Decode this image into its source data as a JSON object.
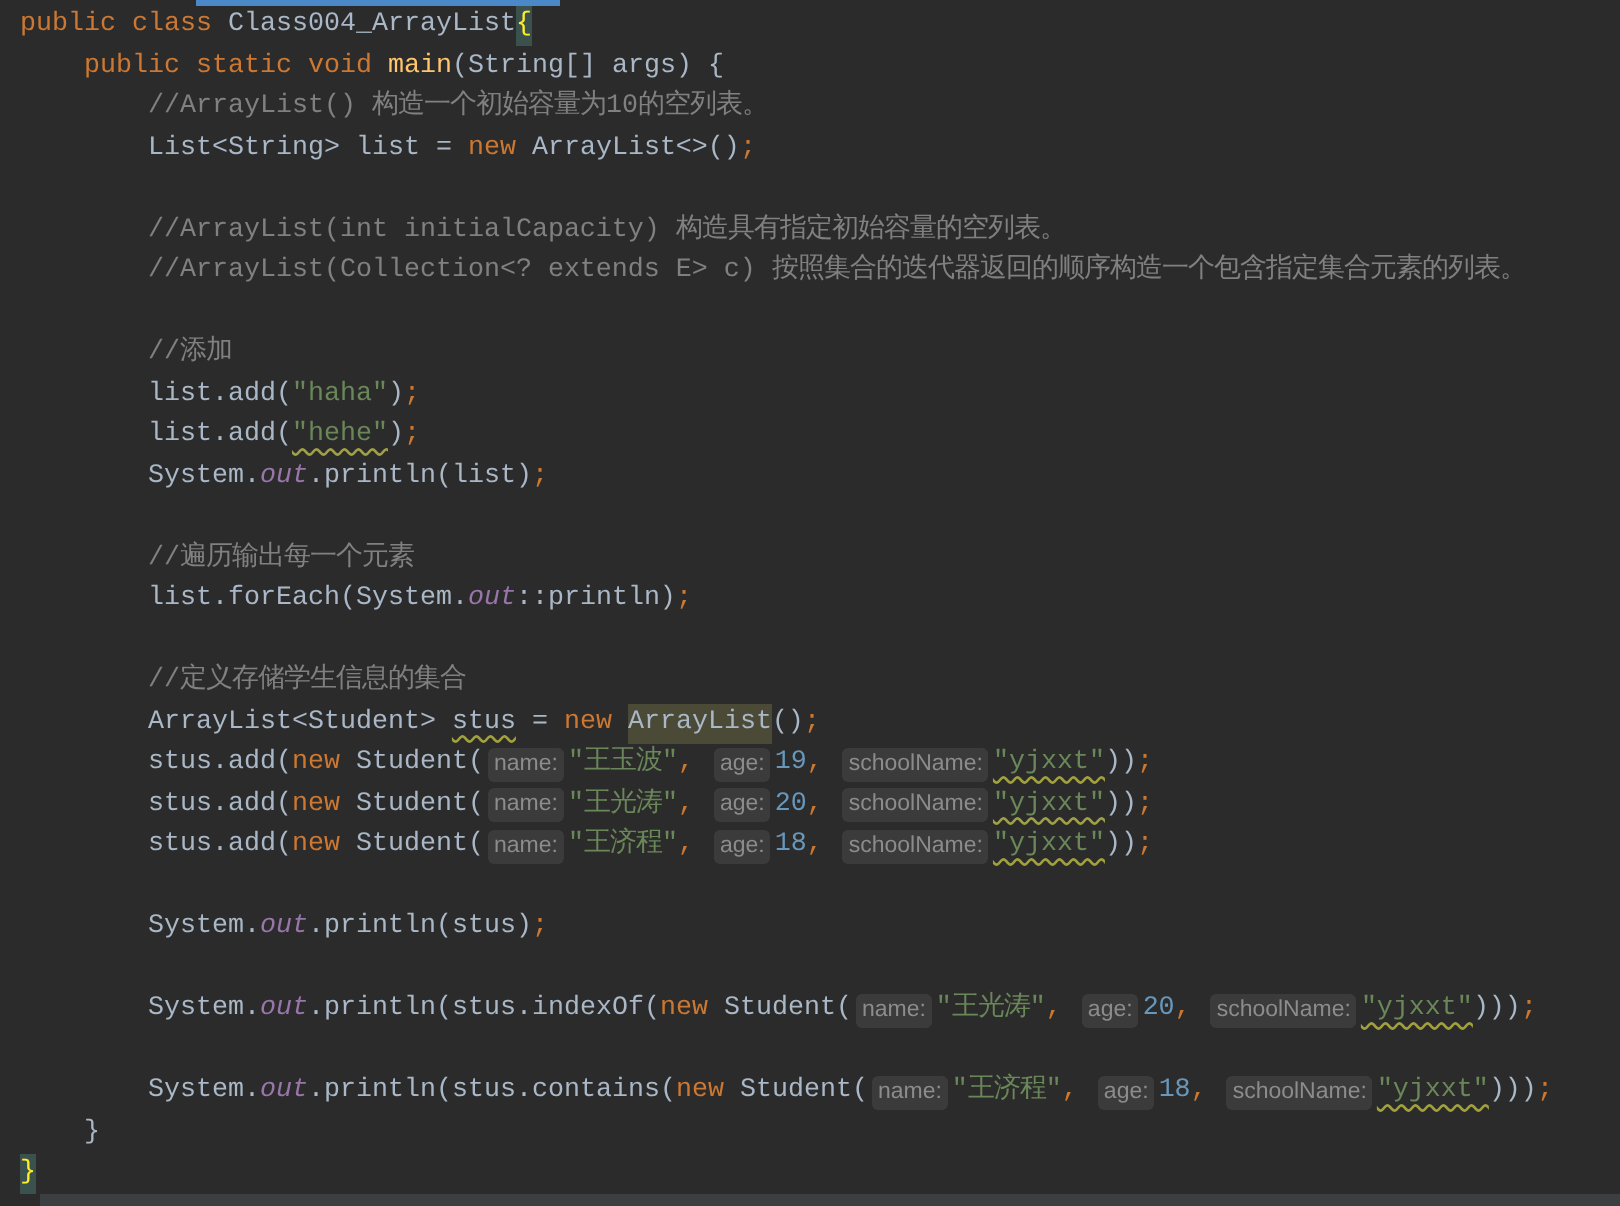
{
  "editor": {
    "lines": [
      {
        "kind": "code",
        "tokens": [
          {
            "kind": "keyword",
            "text": "public class "
          },
          {
            "kind": "plain",
            "text": "Class004_ArrayList"
          },
          {
            "kind": "brace",
            "text": "{"
          }
        ]
      },
      {
        "kind": "code",
        "tokens": [
          {
            "kind": "keyword",
            "text": "    public static void "
          },
          {
            "kind": "method",
            "text": "main"
          },
          {
            "kind": "plain",
            "text": "(String[] args) {"
          }
        ]
      },
      {
        "kind": "code",
        "tokens": [
          {
            "kind": "comment",
            "text": "        //ArrayList() 构造一个初始容量为10的空列表。"
          }
        ]
      },
      {
        "kind": "code",
        "tokens": [
          {
            "kind": "plain",
            "text": "        List<String> list = "
          },
          {
            "kind": "keyword",
            "text": "new "
          },
          {
            "kind": "plain",
            "text": "ArrayList<>()"
          },
          {
            "kind": "keyword",
            "text": ";"
          }
        ]
      },
      {
        "kind": "blank"
      },
      {
        "kind": "code",
        "tokens": [
          {
            "kind": "comment",
            "text": "        //ArrayList(int initialCapacity) 构造具有指定初始容量的空列表。"
          }
        ]
      },
      {
        "kind": "code",
        "tokens": [
          {
            "kind": "comment",
            "text": "        //ArrayList(Collection<? extends E> c) 按照集合的迭代器返回的顺序构造一个包含指定集合元素的列表。"
          }
        ]
      },
      {
        "kind": "blank"
      },
      {
        "kind": "code",
        "tokens": [
          {
            "kind": "comment",
            "text": "        //添加"
          }
        ]
      },
      {
        "kind": "code",
        "tokens": [
          {
            "kind": "plain",
            "text": "        list.add("
          },
          {
            "kind": "string",
            "text": "\"haha\""
          },
          {
            "kind": "plain",
            "text": ")"
          },
          {
            "kind": "keyword",
            "text": ";"
          }
        ]
      },
      {
        "kind": "code",
        "tokens": [
          {
            "kind": "plain",
            "text": "        list.add("
          },
          {
            "kind": "string",
            "text": "\"hehe\"",
            "warning": true
          },
          {
            "kind": "plain",
            "text": ")"
          },
          {
            "kind": "keyword",
            "text": ";"
          }
        ]
      },
      {
        "kind": "code",
        "tokens": [
          {
            "kind": "plain",
            "text": "        System."
          },
          {
            "kind": "field",
            "text": "out"
          },
          {
            "kind": "plain",
            "text": ".println(list)"
          },
          {
            "kind": "keyword",
            "text": ";"
          }
        ]
      },
      {
        "kind": "blank"
      },
      {
        "kind": "code",
        "tokens": [
          {
            "kind": "comment",
            "text": "        //遍历输出每一个元素"
          }
        ]
      },
      {
        "kind": "code",
        "tokens": [
          {
            "kind": "plain",
            "text": "        list.forEach(System."
          },
          {
            "kind": "field",
            "text": "out"
          },
          {
            "kind": "plain",
            "text": "::println)"
          },
          {
            "kind": "keyword",
            "text": ";"
          }
        ]
      },
      {
        "kind": "blank"
      },
      {
        "kind": "code",
        "tokens": [
          {
            "kind": "comment",
            "text": "        //定义存储学生信息的集合"
          }
        ]
      },
      {
        "kind": "code",
        "tokens": [
          {
            "kind": "plain",
            "text": "        ArrayList<Student> "
          },
          {
            "kind": "plain",
            "text": "stus",
            "warning": true
          },
          {
            "kind": "plain",
            "text": " = "
          },
          {
            "kind": "keyword",
            "text": "new "
          },
          {
            "kind": "plain",
            "text": "ArrayList",
            "highlight": true
          },
          {
            "kind": "plain",
            "text": "()"
          },
          {
            "kind": "keyword",
            "text": ";"
          }
        ]
      },
      {
        "kind": "code",
        "tokens": [
          {
            "kind": "plain",
            "text": "        stus.add("
          },
          {
            "kind": "keyword",
            "text": "new "
          },
          {
            "kind": "plain",
            "text": "Student("
          },
          {
            "kind": "hint",
            "text": "name:"
          },
          {
            "kind": "string",
            "text": "\"王玉波\""
          },
          {
            "kind": "keyword",
            "text": ", "
          },
          {
            "kind": "hint",
            "text": "age:"
          },
          {
            "kind": "number",
            "text": "19"
          },
          {
            "kind": "keyword",
            "text": ", "
          },
          {
            "kind": "hint",
            "text": "schoolName:"
          },
          {
            "kind": "string",
            "text": "\"yjxxt\"",
            "warning": true
          },
          {
            "kind": "plain",
            "text": "))"
          },
          {
            "kind": "keyword",
            "text": ";"
          }
        ]
      },
      {
        "kind": "code",
        "tokens": [
          {
            "kind": "plain",
            "text": "        stus.add("
          },
          {
            "kind": "keyword",
            "text": "new "
          },
          {
            "kind": "plain",
            "text": "Student("
          },
          {
            "kind": "hint",
            "text": "name:"
          },
          {
            "kind": "string",
            "text": "\"王光涛\""
          },
          {
            "kind": "keyword",
            "text": ", "
          },
          {
            "kind": "hint",
            "text": "age:"
          },
          {
            "kind": "number",
            "text": "20"
          },
          {
            "kind": "keyword",
            "text": ", "
          },
          {
            "kind": "hint",
            "text": "schoolName:"
          },
          {
            "kind": "string",
            "text": "\"yjxxt\"",
            "warning": true
          },
          {
            "kind": "plain",
            "text": "))"
          },
          {
            "kind": "keyword",
            "text": ";"
          }
        ]
      },
      {
        "kind": "code",
        "tokens": [
          {
            "kind": "plain",
            "text": "        stus.add("
          },
          {
            "kind": "keyword",
            "text": "new "
          },
          {
            "kind": "plain",
            "text": "Student("
          },
          {
            "kind": "hint",
            "text": "name:"
          },
          {
            "kind": "string",
            "text": "\"王济程\""
          },
          {
            "kind": "keyword",
            "text": ", "
          },
          {
            "kind": "hint",
            "text": "age:"
          },
          {
            "kind": "number",
            "text": "18"
          },
          {
            "kind": "keyword",
            "text": ", "
          },
          {
            "kind": "hint",
            "text": "schoolName:"
          },
          {
            "kind": "string",
            "text": "\"yjxxt\"",
            "warning": true
          },
          {
            "kind": "plain",
            "text": "))"
          },
          {
            "kind": "keyword",
            "text": ";"
          }
        ]
      },
      {
        "kind": "blank"
      },
      {
        "kind": "code",
        "tokens": [
          {
            "kind": "plain",
            "text": "        System."
          },
          {
            "kind": "field",
            "text": "out"
          },
          {
            "kind": "plain",
            "text": ".println(stus)"
          },
          {
            "kind": "keyword",
            "text": ";"
          }
        ]
      },
      {
        "kind": "blank"
      },
      {
        "kind": "code",
        "tokens": [
          {
            "kind": "plain",
            "text": "        System."
          },
          {
            "kind": "field",
            "text": "out"
          },
          {
            "kind": "plain",
            "text": ".println(stus.indexOf("
          },
          {
            "kind": "keyword",
            "text": "new "
          },
          {
            "kind": "plain",
            "text": "Student("
          },
          {
            "kind": "hint",
            "text": "name:"
          },
          {
            "kind": "string",
            "text": "\"王光涛\""
          },
          {
            "kind": "keyword",
            "text": ", "
          },
          {
            "kind": "hint",
            "text": "age:"
          },
          {
            "kind": "number",
            "text": "20"
          },
          {
            "kind": "keyword",
            "text": ", "
          },
          {
            "kind": "hint",
            "text": "schoolName:"
          },
          {
            "kind": "string",
            "text": "\"yjxxt\"",
            "warning": true
          },
          {
            "kind": "plain",
            "text": ")))"
          },
          {
            "kind": "keyword",
            "text": ";"
          }
        ]
      },
      {
        "kind": "blank"
      },
      {
        "kind": "code",
        "tokens": [
          {
            "kind": "plain",
            "text": "        System."
          },
          {
            "kind": "field",
            "text": "out"
          },
          {
            "kind": "plain",
            "text": ".println(stus.contains("
          },
          {
            "kind": "keyword",
            "text": "new "
          },
          {
            "kind": "plain",
            "text": "Student("
          },
          {
            "kind": "hint",
            "text": "name:"
          },
          {
            "kind": "string",
            "text": "\"王济程\""
          },
          {
            "kind": "keyword",
            "text": ", "
          },
          {
            "kind": "hint",
            "text": "age:"
          },
          {
            "kind": "number",
            "text": "18"
          },
          {
            "kind": "keyword",
            "text": ", "
          },
          {
            "kind": "hint",
            "text": "schoolName:"
          },
          {
            "kind": "string",
            "text": "\"yjxxt\"",
            "warning": true
          },
          {
            "kind": "plain",
            "text": ")))"
          },
          {
            "kind": "keyword",
            "text": ";"
          }
        ]
      },
      {
        "kind": "code",
        "tokens": [
          {
            "kind": "plain",
            "text": "    }"
          }
        ]
      },
      {
        "kind": "code",
        "tokens": [
          {
            "kind": "brace",
            "text": "}"
          }
        ]
      }
    ]
  }
}
